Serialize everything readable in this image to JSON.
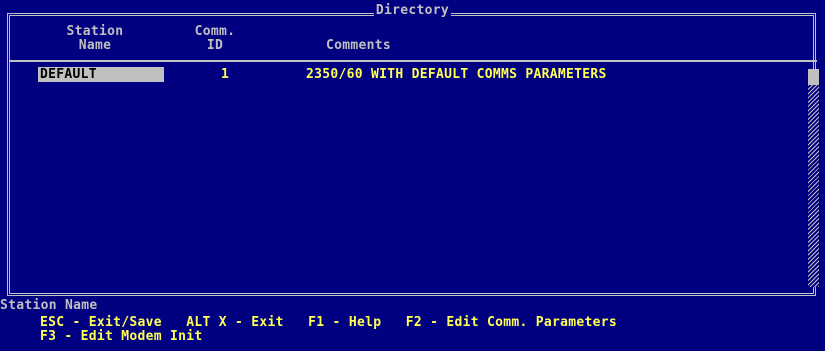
{
  "window": {
    "title": "Directory"
  },
  "columns": {
    "station_name": [
      "Station",
      "Name"
    ],
    "comm_id": [
      "Comm.",
      "ID"
    ],
    "comments": "Comments"
  },
  "rows": [
    {
      "station": "DEFAULT",
      "id": "1",
      "comments": "2350/60 WITH DEFAULT COMMS PARAMETERS"
    }
  ],
  "status": {
    "field_label": "Station Name"
  },
  "keys": {
    "line1": "ESC - Exit/Save   ALT X - Exit   F1 - Help   F2 - Edit Comm. Parameters",
    "line2": "F3 - Edit Modem Init"
  },
  "colors": {
    "background": "#000080",
    "text": "#c0c0c0",
    "highlight": "#ffff54"
  }
}
